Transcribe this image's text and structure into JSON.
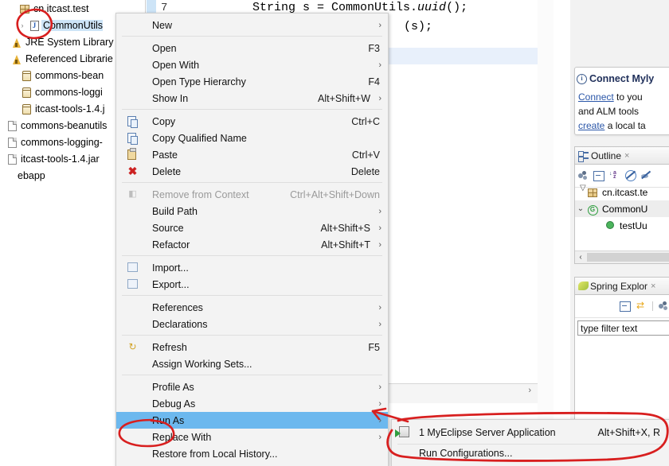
{
  "explorer": {
    "name": "package-explorer",
    "items": [
      {
        "label": "cn.itcast.test",
        "icon": "package-icon",
        "indent": 10,
        "twisty": "",
        "selected": false
      },
      {
        "label": "CommonUtils",
        "icon": "java-file-icon",
        "indent": 22,
        "twisty": "›",
        "selected": true
      },
      {
        "label": "JRE System Library",
        "icon": "library-icon",
        "indent": 0,
        "twisty": "",
        "selected": false
      },
      {
        "label": "Referenced Librarie",
        "icon": "library-icon",
        "indent": 0,
        "twisty": "",
        "selected": false
      },
      {
        "label": "commons-bean",
        "icon": "jar-icon",
        "indent": 12,
        "twisty": "",
        "selected": false
      },
      {
        "label": "commons-loggi",
        "icon": "jar-icon",
        "indent": 12,
        "twisty": "",
        "selected": false
      },
      {
        "label": "itcast-tools-1.4.j",
        "icon": "jar-icon",
        "indent": 12,
        "twisty": "",
        "selected": false
      },
      {
        "label": "commons-beanutils",
        "icon": "file-icon",
        "indent": -6,
        "twisty": "",
        "selected": false
      },
      {
        "label": "commons-logging-",
        "icon": "file-icon",
        "indent": -6,
        "twisty": "",
        "selected": false
      },
      {
        "label": "itcast-tools-1.4.jar",
        "icon": "file-icon",
        "indent": -6,
        "twisty": "",
        "selected": false
      },
      {
        "label": "ebapp",
        "icon": "none",
        "indent": -10,
        "twisty": "",
        "selected": false
      }
    ]
  },
  "editor": {
    "name": "java-editor",
    "line_number": "7",
    "code_line_1": "String s = CommonUtils.",
    "code_line_1_italic": "uuid",
    "code_line_1_tail": "();",
    "code_line_2": "(s);"
  },
  "context_menu": {
    "name": "file-context-menu",
    "items": [
      {
        "label": "New",
        "accel": "",
        "arrow": true,
        "icon": "",
        "disabled": false,
        "selected": false,
        "sep_after": true
      },
      {
        "label": "Open",
        "accel": "F3",
        "arrow": false,
        "icon": "",
        "disabled": false,
        "selected": false,
        "sep_after": false
      },
      {
        "label": "Open With",
        "accel": "",
        "arrow": true,
        "icon": "",
        "disabled": false,
        "selected": false,
        "sep_after": false
      },
      {
        "label": "Open Type Hierarchy",
        "accel": "F4",
        "arrow": false,
        "icon": "",
        "disabled": false,
        "selected": false,
        "sep_after": false
      },
      {
        "label": "Show In",
        "accel": "Alt+Shift+W",
        "arrow": true,
        "icon": "",
        "disabled": false,
        "selected": false,
        "sep_after": true
      },
      {
        "label": "Copy",
        "accel": "Ctrl+C",
        "arrow": false,
        "icon": "copy-icon",
        "disabled": false,
        "selected": false,
        "sep_after": false
      },
      {
        "label": "Copy Qualified Name",
        "accel": "",
        "arrow": false,
        "icon": "copy-qualified-icon",
        "disabled": false,
        "selected": false,
        "sep_after": false
      },
      {
        "label": "Paste",
        "accel": "Ctrl+V",
        "arrow": false,
        "icon": "paste-icon",
        "disabled": false,
        "selected": false,
        "sep_after": false
      },
      {
        "label": "Delete",
        "accel": "Delete",
        "arrow": false,
        "icon": "delete-icon",
        "disabled": false,
        "selected": false,
        "sep_after": true
      },
      {
        "label": "Remove from Context",
        "accel": "Ctrl+Alt+Shift+Down",
        "arrow": false,
        "icon": "remove-context-icon",
        "disabled": true,
        "selected": false,
        "sep_after": false
      },
      {
        "label": "Build Path",
        "accel": "",
        "arrow": true,
        "icon": "",
        "disabled": false,
        "selected": false,
        "sep_after": false
      },
      {
        "label": "Source",
        "accel": "Alt+Shift+S",
        "arrow": true,
        "icon": "",
        "disabled": false,
        "selected": false,
        "sep_after": false
      },
      {
        "label": "Refactor",
        "accel": "Alt+Shift+T",
        "arrow": true,
        "icon": "",
        "disabled": false,
        "selected": false,
        "sep_after": true
      },
      {
        "label": "Import...",
        "accel": "",
        "arrow": false,
        "icon": "import-icon",
        "disabled": false,
        "selected": false,
        "sep_after": false
      },
      {
        "label": "Export...",
        "accel": "",
        "arrow": false,
        "icon": "export-icon",
        "disabled": false,
        "selected": false,
        "sep_after": true
      },
      {
        "label": "References",
        "accel": "",
        "arrow": true,
        "icon": "",
        "disabled": false,
        "selected": false,
        "sep_after": false
      },
      {
        "label": "Declarations",
        "accel": "",
        "arrow": true,
        "icon": "",
        "disabled": false,
        "selected": false,
        "sep_after": true
      },
      {
        "label": "Refresh",
        "accel": "F5",
        "arrow": false,
        "icon": "refresh-icon",
        "disabled": false,
        "selected": false,
        "sep_after": false
      },
      {
        "label": "Assign Working Sets...",
        "accel": "",
        "arrow": false,
        "icon": "",
        "disabled": false,
        "selected": false,
        "sep_after": true
      },
      {
        "label": "Profile As",
        "accel": "",
        "arrow": true,
        "icon": "",
        "disabled": false,
        "selected": false,
        "sep_after": false
      },
      {
        "label": "Debug As",
        "accel": "",
        "arrow": true,
        "icon": "",
        "disabled": false,
        "selected": false,
        "sep_after": false
      },
      {
        "label": "Run As",
        "accel": "",
        "arrow": true,
        "icon": "",
        "disabled": false,
        "selected": true,
        "sep_after": false
      },
      {
        "label": "Replace With",
        "accel": "",
        "arrow": true,
        "icon": "",
        "disabled": false,
        "selected": false,
        "sep_after": false
      },
      {
        "label": "Restore from Local History...",
        "accel": "",
        "arrow": false,
        "icon": "",
        "disabled": false,
        "selected": false,
        "sep_after": false
      }
    ]
  },
  "submenu": {
    "name": "run-as-submenu",
    "items": [
      {
        "label": "1 MyEclipse Server Application",
        "accel": "Alt+Shift+X, R",
        "icon": "server-run-icon"
      },
      {
        "label": "Run Configurations...",
        "accel": "",
        "icon": ""
      }
    ]
  },
  "mylyn": {
    "name": "connect-mylyn-notice",
    "title": "Connect Myly",
    "line1_link": "Connect",
    "line1_rest": " to you",
    "line2": "and ALM tools",
    "line3_link": "create",
    "line3_rest": " a local ta"
  },
  "outline": {
    "name": "outline-view",
    "tab_label": "Outline",
    "close_glyph": "×",
    "toolbar_icons": [
      "hide-fields-icon",
      "collapse-all-icon",
      "sort-az-icon",
      "hide-static-icon",
      "hide-nonpublic-icon",
      "view-menu-icon"
    ],
    "rows": [
      {
        "label": "cn.itcast.te",
        "icon": "package-icon",
        "indent": 30,
        "twisty": "",
        "selected": false
      },
      {
        "label": "CommonU",
        "icon": "class-icon",
        "indent": 30,
        "twisty": "⌄",
        "selected": true
      },
      {
        "label": "testUu",
        "icon": "method-icon",
        "indent": 52,
        "twisty": "",
        "selected": false
      }
    ],
    "scroll_left_glyph": "‹"
  },
  "spring": {
    "name": "spring-explorer-view",
    "tab_label": "Spring Explor",
    "close_glyph": "×",
    "filter_text": "type filter text",
    "toolbar_icons": [
      "collapse-all-icon",
      "link-editor-icon",
      "view-menu-icon"
    ]
  },
  "colors": {
    "selection_blue": "#6cb8ee",
    "tree_selection": "#cde4f7",
    "annotation_red": "#d81f1f",
    "link_blue": "#2a56a8"
  }
}
